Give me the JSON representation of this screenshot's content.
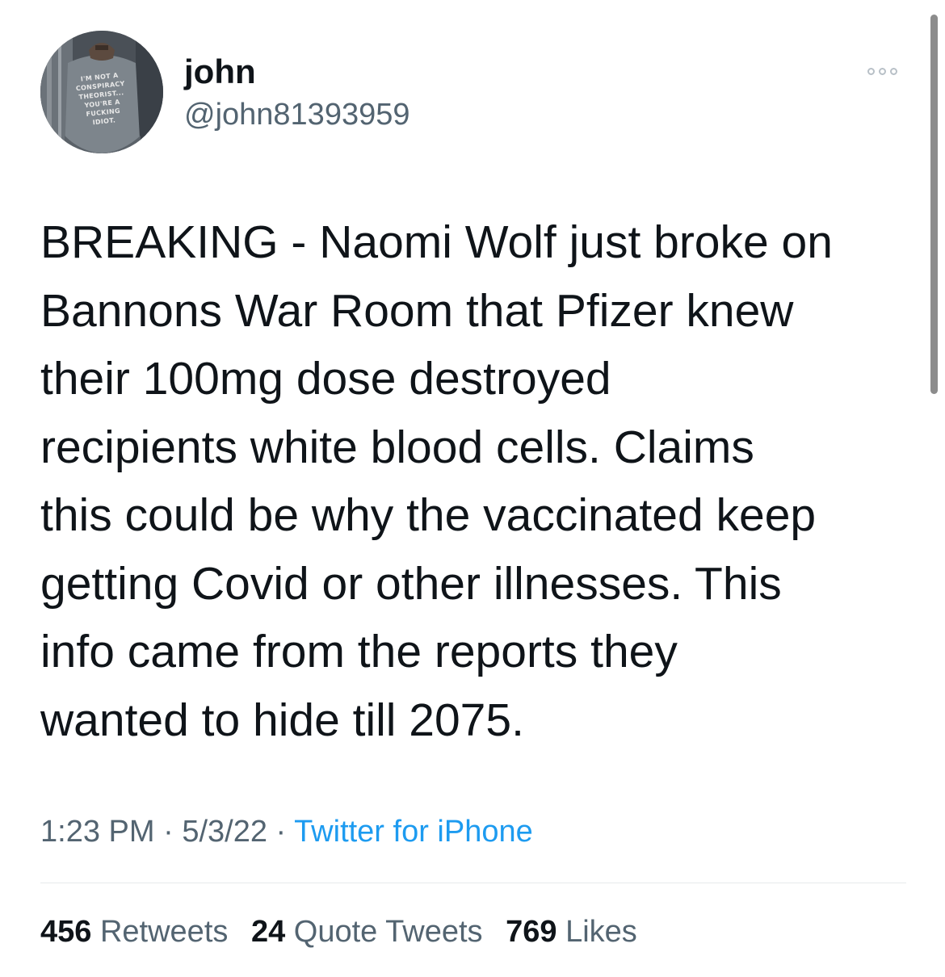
{
  "user": {
    "display_name": "john",
    "handle": "@john81393959",
    "avatar_shirt_text": [
      "I'M NOT A",
      "CONSPIRACY",
      "THEORIST...",
      "YOU'RE A",
      "FUCKING",
      "IDIOT."
    ]
  },
  "tweet": {
    "text_lines": [
      "BREAKING - Naomi Wolf just broke on",
      "Bannons War Room that Pfizer knew",
      "their 100mg dose destroyed",
      "recipients white blood cells. Claims",
      "this could be why the vaccinated keep",
      "getting Covid or other illnesses. This",
      "info came from the reports they",
      "wanted to hide till 2075."
    ],
    "time": "1:23 PM",
    "separator": "·",
    "date": "5/3/22",
    "source": "Twitter for iPhone"
  },
  "stats": {
    "retweets_count": "456",
    "retweets_label": "Retweets",
    "quotes_count": "24",
    "quotes_label": "Quote Tweets",
    "likes_count": "769",
    "likes_label": "Likes"
  },
  "colors": {
    "text_primary": "#0f1419",
    "text_secondary": "#536471",
    "link": "#1d9bf0",
    "divider": "#e6e9eb"
  },
  "icons": {
    "more": "more-horizontal-icon"
  }
}
